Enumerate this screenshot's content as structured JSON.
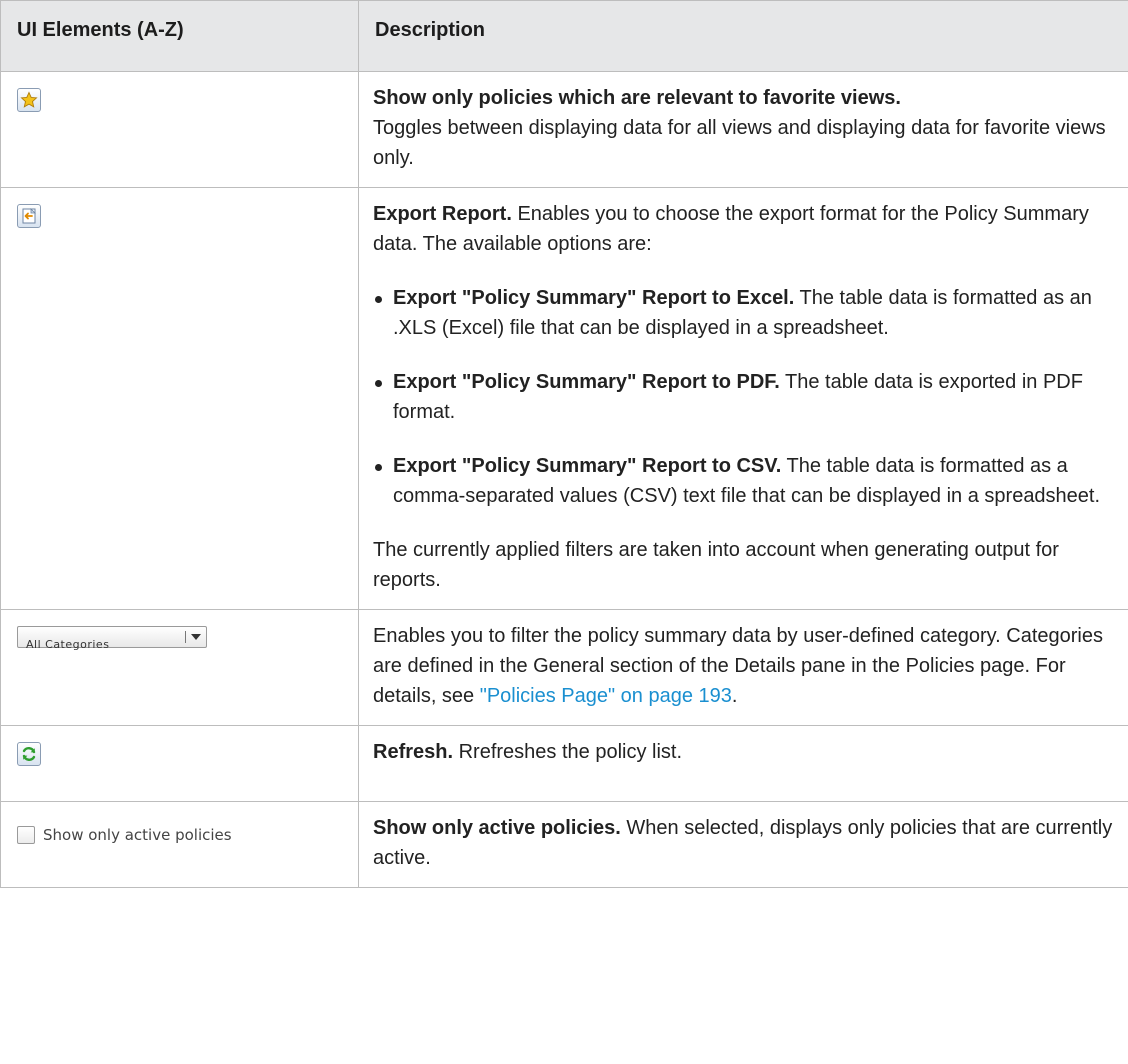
{
  "header": {
    "col1": "UI Elements (A-Z)",
    "col2": "Description"
  },
  "rows": [
    {
      "icon": "star-icon",
      "title": "Show only policies which are relevant to favorite views.",
      "text": "Toggles between displaying data for all views and displaying data for favorite views only."
    },
    {
      "icon": "export-icon",
      "title": "Export Report.",
      "text": "Enables you to choose the export format for the Policy Summary data. The available options are:",
      "options": [
        {
          "title": "Export \"Policy Summary\" Report to Excel.",
          "text": "The table data is formatted as an .XLS (Excel) file that can be displayed in a spreadsheet."
        },
        {
          "title": "Export \"Policy Summary\" Report to PDF.",
          "text": "The table data is exported in PDF format."
        },
        {
          "title": "Export \"Policy Summary\" Report to CSV.",
          "text": "The table data is formatted as a comma-separated values (CSV) text file that can be displayed in a spreadsheet."
        }
      ],
      "note": "The currently applied filters are taken into account when generating output for reports."
    },
    {
      "dropdown_label": "All Categories",
      "text": "Enables you to filter the policy summary data by user-defined category. Categories are defined in the General section of the Details pane in the Policies page. For details, see",
      "link": "\"Policies Page\" on page 193",
      "text_end": "."
    },
    {
      "icon": "refresh-icon",
      "title": "Refresh.",
      "text": "Rrefreshes the policy list."
    },
    {
      "checkbox_label": "Show only active policies",
      "checked": false,
      "title": "Show only active policies.",
      "text": "When selected, displays only policies that are currently active."
    }
  ]
}
